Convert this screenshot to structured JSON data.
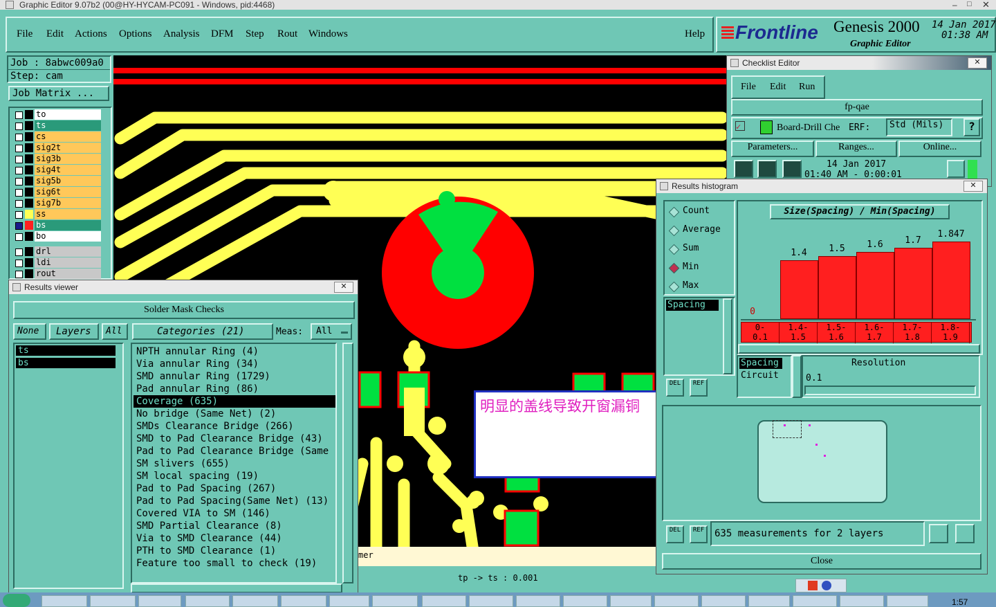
{
  "window_title": "Graphic Editor 9.07b2 (00@HY-HYCAM-PC091 - Windows, pid:4468)",
  "menu": {
    "file": "File",
    "edit": "Edit",
    "actions": "Actions",
    "options": "Options",
    "analysis": "Analysis",
    "dfm": "DFM",
    "step": "Step",
    "rout": "Rout",
    "windows": "Windows",
    "help": "Help"
  },
  "brand": {
    "logo": "Frontline",
    "product": "Genesis 2000",
    "subtitle": "Graphic Editor",
    "date": "14 Jan 2017",
    "time": "01:38 AM"
  },
  "job": {
    "job_label": "Job : 8abwc009a0",
    "step_label": "Step: cam",
    "matrix_button": "Job Matrix ..."
  },
  "layers": [
    {
      "name": "to",
      "color": "#ffffff",
      "text_color": "#000000",
      "checked": false
    },
    {
      "name": "ts",
      "color": "#2a9a7a",
      "text_color": "#ffffff",
      "checked": false
    },
    {
      "name": "cs",
      "color": "#ffc85a",
      "text_color": "#000000",
      "checked": false
    },
    {
      "name": "sig2t",
      "color": "#ffc85a",
      "text_color": "#000000",
      "checked": false
    },
    {
      "name": "sig3b",
      "color": "#ffc85a",
      "text_color": "#000000",
      "checked": false
    },
    {
      "name": "sig4t",
      "color": "#ffc85a",
      "text_color": "#000000",
      "checked": false
    },
    {
      "name": "sig5b",
      "color": "#ffc85a",
      "text_color": "#000000",
      "checked": false
    },
    {
      "name": "sig6t",
      "color": "#ffc85a",
      "text_color": "#000000",
      "checked": false
    },
    {
      "name": "sig7b",
      "color": "#ffc85a",
      "text_color": "#000000",
      "checked": false
    },
    {
      "name": "ss",
      "color": "#ffc85a",
      "text_color": "#000000",
      "checked": false
    },
    {
      "name": "bs",
      "color": "#2a9a7a",
      "text_color": "#ffffff",
      "checked": true
    },
    {
      "name": "bo",
      "color": "#ffffff",
      "text_color": "#000000",
      "checked": false
    },
    {
      "name": "drl",
      "color": "#c8c8c8",
      "text_color": "#000000",
      "checked": false
    },
    {
      "name": "ldi",
      "color": "#c8c8c8",
      "text_color": "#000000",
      "checked": false
    },
    {
      "name": "rout",
      "color": "#c8c8c8",
      "text_color": "#000000",
      "checked": false
    }
  ],
  "results_viewer": {
    "title": "Results viewer",
    "header": "Solder Mask Checks",
    "none_btn": "None",
    "layers_btn": "Layers",
    "all_btn": "All",
    "categories_label": "Categories (21)",
    "meas_label": "Meas:",
    "meas_value": "All",
    "layers": [
      "ts",
      "bs"
    ],
    "categories": [
      "NPTH annular Ring (4)",
      "Via annular Ring (34)",
      "SMD annular Ring (1729)",
      "Pad annular Ring (86)",
      "Coverage (635)",
      "No bridge (Same Net) (2)",
      "SMDs Clearance Bridge (266)",
      "SMD to Pad Clearance Bridge (43)",
      "Pad to Pad Clearance Bridge (Same",
      "SM slivers (655)",
      "SM local spacing (19)",
      "Pad to Pad Spacing (267)",
      "Pad to Pad Spacing(Same Net) (13)",
      "Covered VIA to SM (146)",
      "SMD Partial Clearance (8)",
      "Via to SMD Clearance (44)",
      "PTH to SMD Clearance (1)",
      "Feature too small to check (19)"
    ],
    "selected_index": 4
  },
  "annotation_text": "明显的盖线导致开窗漏铜",
  "status_partial": "mer",
  "status_line": "tp -> ts : 0.001",
  "checklist": {
    "title": "Checklist Editor",
    "menu_file": "File",
    "menu_edit": "Edit",
    "menu_run": "Run",
    "name": "fp-qae",
    "row_label": "Board-Drill Che",
    "erf_label": "ERF:",
    "erf_value": "Std (Mils)",
    "help_btn": "?",
    "parameters_btn": "Parameters...",
    "ranges_btn": "Ranges...",
    "online_btn": "Online...",
    "date_line": "14 Jan 2017",
    "time_line": "01:40 AM - 0:00:01"
  },
  "histogram": {
    "title": "Results histogram",
    "chart_title": "Size(Spacing) / Min(Spacing)",
    "modes": [
      "Count",
      "Average",
      "Sum",
      "Min",
      "Max"
    ],
    "selected_mode": "Min",
    "attribute": "Spacing",
    "del_btn": "DEL",
    "ref_btn": "REF",
    "attr_list": [
      "Spacing",
      "Circuit"
    ],
    "resolution_label": "Resolution",
    "resolution_value": "0.1",
    "measurements_text": "635 measurements for 2 layers",
    "close_btn": "Close",
    "chart_data": {
      "type": "bar",
      "categories": [
        "0-\n0.1",
        "1.4-\n1.5",
        "1.5-\n1.6",
        "1.6-\n1.7",
        "1.7-\n1.8",
        "1.8-\n1.9"
      ],
      "values": [
        0,
        1.4,
        1.5,
        1.6,
        1.7,
        1.847
      ],
      "value_labels": [
        "0",
        "1.4",
        "1.5",
        "1.6",
        "1.7",
        "1.847"
      ],
      "title": "Size(Spacing) / Min(Spacing)",
      "ylim": [
        0,
        2.0
      ],
      "colors": {
        "bar": "#ff1f1f",
        "zero_label": "#cc0000"
      }
    }
  },
  "taskbar": {
    "clock": "1:57"
  },
  "colors": {
    "panel": "#6fc7b5",
    "trace": "#ffff55",
    "mask_pad": "#ff0000",
    "copper": "#00e040"
  }
}
